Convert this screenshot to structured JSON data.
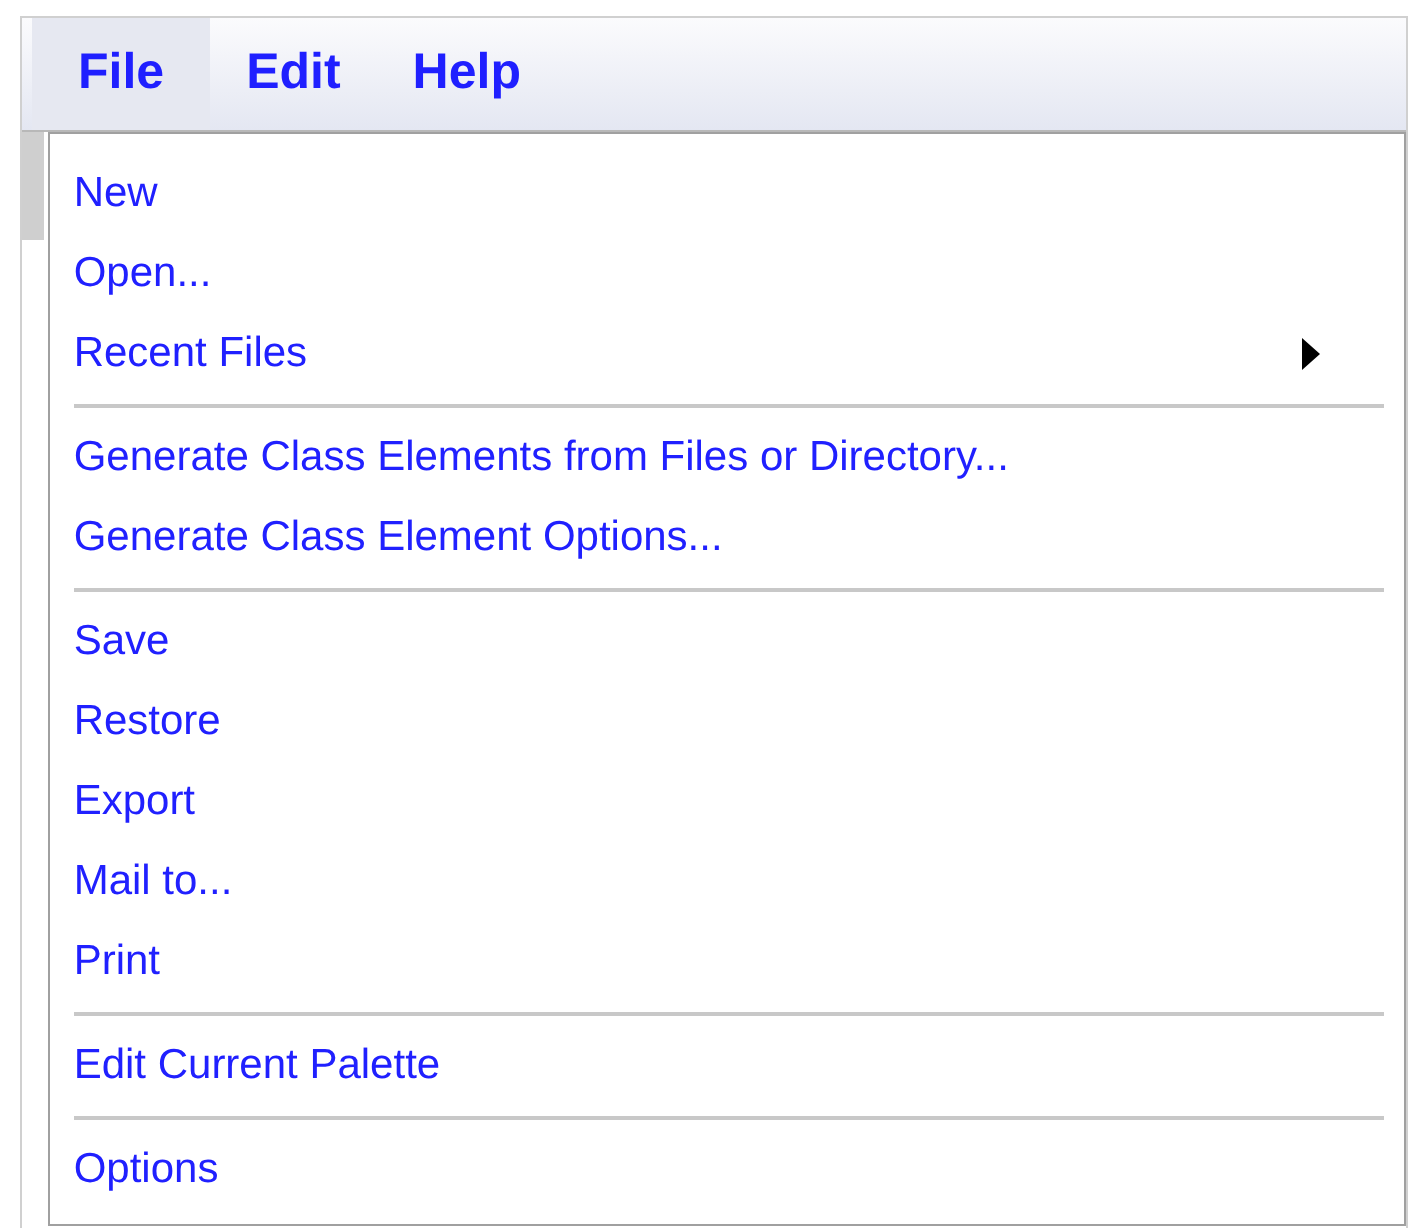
{
  "menubar": [
    {
      "label": "File",
      "selected": true
    },
    {
      "label": "Edit",
      "selected": false
    },
    {
      "label": "Help",
      "selected": false
    }
  ],
  "menu": {
    "sections": [
      {
        "items": [
          {
            "label": "New",
            "submenu": false
          },
          {
            "label": "Open...",
            "submenu": false
          },
          {
            "label": "Recent Files",
            "submenu": true
          }
        ]
      },
      {
        "items": [
          {
            "label": "Generate Class Elements from Files or Directory...",
            "submenu": false
          },
          {
            "label": "Generate Class Element Options...",
            "submenu": false
          }
        ]
      },
      {
        "items": [
          {
            "label": "Save",
            "submenu": false
          },
          {
            "label": "Restore",
            "submenu": false
          },
          {
            "label": "Export",
            "submenu": false
          },
          {
            "label": "Mail to...",
            "submenu": false
          },
          {
            "label": "Print",
            "submenu": false
          }
        ]
      },
      {
        "items": [
          {
            "label": "Edit Current Palette",
            "submenu": false
          }
        ]
      },
      {
        "items": [
          {
            "label": "Options",
            "submenu": false
          }
        ]
      }
    ]
  }
}
